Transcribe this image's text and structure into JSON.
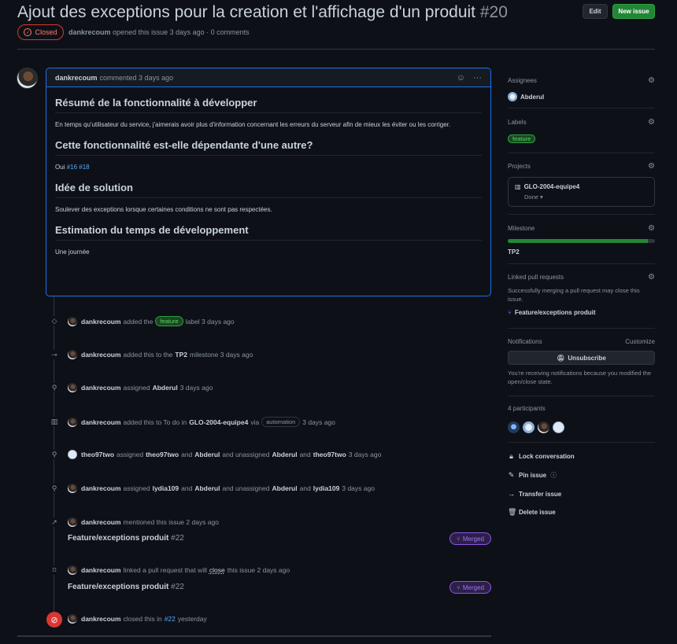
{
  "issue": {
    "title": "Ajout des exceptions pour la creation et l'affichage d'un produit",
    "number": "#20",
    "state": "Closed",
    "author": "dankrecoum",
    "opened_text": "opened this issue 3 days ago · 0 comments"
  },
  "header_buttons": {
    "edit": "Edit",
    "new_issue": "New issue"
  },
  "comment": {
    "author": "dankrecoum",
    "when": "commented 3 days ago",
    "sections": [
      {
        "heading": "Résumé de la fonctionnalité à développer",
        "text": "En temps qu'utilisateur du service, j'aimerais avoir plus d'information concernant les erreurs du serveur afin de mieux les éviter ou les corriger."
      },
      {
        "heading": "Cette fonctionnalité est-elle dépendante d'une autre?",
        "text": "Oui",
        "links": [
          "#16",
          "#18"
        ]
      },
      {
        "heading": "Idée de solution",
        "text": "Soulever des exceptions lorsque certaines conditions ne sont pas respectées."
      },
      {
        "heading": "Estimation du temps de développement",
        "text": "Une journée"
      }
    ]
  },
  "timeline": {
    "e1": {
      "user": "dankrecoum",
      "pre": "added the",
      "label": "feature",
      "post": "label 3 days ago"
    },
    "e2": {
      "user": "dankrecoum",
      "pre": "added this to the",
      "milestone": "TP2",
      "post": "milestone 3 days ago"
    },
    "e3": {
      "user": "dankrecoum",
      "pre": "assigned",
      "who": "Abderul",
      "post": "3 days ago"
    },
    "e4": {
      "user": "dankrecoum",
      "pre": "added this to To do in",
      "project": "GLO-2004-equipe4",
      "via": "via",
      "label": "automation",
      "post": "3 days ago"
    },
    "e5": {
      "user": "theo97two",
      "pre": "assigned",
      "a1": "theo97two",
      "and1": "and",
      "a2": "Abderul",
      "mid": "and unassigned",
      "u1": "Abderul",
      "and2": "and",
      "u2": "theo97two",
      "post": "3 days ago"
    },
    "e6": {
      "user": "dankrecoum",
      "pre": "assigned",
      "a1": "lydia109",
      "and1": "and",
      "a2": "Abderul",
      "mid": "and unassigned",
      "u1": "Abderul",
      "and2": "and",
      "u2": "lydia109",
      "post": "3 days ago"
    },
    "e7": {
      "user": "dankrecoum",
      "text": "mentioned this issue 2 days ago",
      "pr_title": "Feature/exceptions produit",
      "pr_num": "#22",
      "badge": "Merged"
    },
    "e8": {
      "user": "dankrecoum",
      "pre": "linked a pull request that will",
      "close": "close",
      "post": "this issue 2 days ago",
      "pr_title": "Feature/exceptions produit",
      "pr_num": "#22",
      "badge": "Merged"
    },
    "e9": {
      "user": "dankrecoum",
      "pre": "closed this in",
      "ref": "#22",
      "post": "yesterday"
    }
  },
  "sidebar": {
    "assignees": {
      "heading": "Assignees",
      "value": "Abderul"
    },
    "labels": {
      "heading": "Labels",
      "value": "feature"
    },
    "projects": {
      "heading": "Projects",
      "name": "GLO-2004-equipe4",
      "status": "Done"
    },
    "milestone": {
      "heading": "Milestone",
      "name": "TP2",
      "progress": 0.95
    },
    "linked_prs": {
      "heading": "Linked pull requests",
      "note": "Successfully merging a pull request may close this issue.",
      "pr": "Feature/exceptions produit"
    },
    "notifications": {
      "heading": "Notifications",
      "customize": "Customize",
      "button": "Unsubscribe",
      "note": "You're receiving notifications because you modified the open/close state."
    },
    "participants": {
      "heading": "4 participants"
    },
    "actions": {
      "lock": "Lock conversation",
      "pin": "Pin issue",
      "transfer": "Transfer issue",
      "delete": "Delete issue"
    }
  },
  "colors": {
    "accent": "#58a6ff",
    "closed": "#da3633",
    "merged": "#8957e5",
    "success": "#238636"
  }
}
